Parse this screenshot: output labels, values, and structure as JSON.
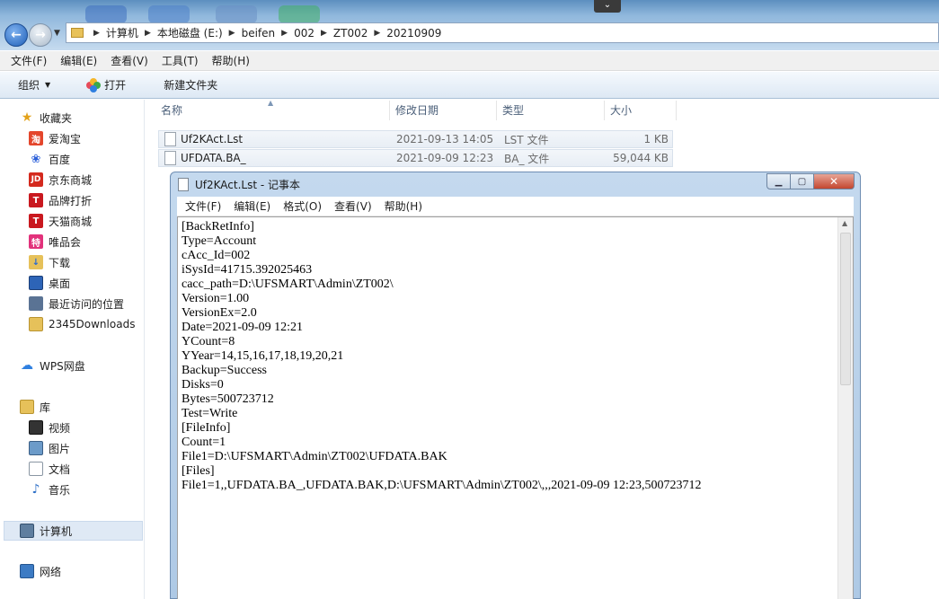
{
  "window": {
    "minimize_tab": "⌄"
  },
  "address": {
    "crumbs": [
      "计算机",
      "本地磁盘 (E:)",
      "beifen",
      "002",
      "ZT002",
      "20210909"
    ]
  },
  "menubar": {
    "items": [
      "文件(F)",
      "编辑(E)",
      "查看(V)",
      "工具(T)",
      "帮助(H)"
    ]
  },
  "commandbar": {
    "organize": "组织",
    "open": "打开",
    "new_folder": "新建文件夹"
  },
  "sidebar": {
    "favorites": "收藏夹",
    "fav_items": [
      "爱淘宝",
      "百度",
      "京东商城",
      "品牌打折",
      "天猫商城",
      "唯品会",
      "下载",
      "桌面",
      "最近访问的位置",
      "2345Downloads"
    ],
    "wps": "WPS网盘",
    "library": "库",
    "lib_items": [
      "视频",
      "图片",
      "文档",
      "音乐"
    ],
    "computer": "计算机",
    "network": "网络"
  },
  "file_list": {
    "headers": [
      "名称",
      "修改日期",
      "类型",
      "大小"
    ],
    "rows": [
      {
        "name": "Uf2KAct.Lst",
        "date": "2021-09-13 14:05",
        "type": "LST 文件",
        "size": "1 KB"
      },
      {
        "name": "UFDATA.BA_",
        "date": "2021-09-09 12:23",
        "type": "BA_ 文件",
        "size": "59,044 KB"
      }
    ]
  },
  "notepad": {
    "title": "Uf2KAct.Lst - 记事本",
    "menu": [
      "文件(F)",
      "编辑(E)",
      "格式(O)",
      "查看(V)",
      "帮助(H)"
    ],
    "content": "[BackRetInfo]\nType=Account\ncAcc_Id=002\niSysId=41715.392025463\ncacc_path=D:\\UFSMART\\Admin\\ZT002\\\nVersion=1.00\nVersionEx=2.0\nDate=2021-09-09 12:21\nYCount=8\nYYear=14,15,16,17,18,19,20,21\nBackup=Success\nDisks=0\nBytes=500723712\nTest=Write\n[FileInfo]\nCount=1\nFile1=D:\\UFSMART\\Admin\\ZT002\\UFDATA.BAK\n[Files]\nFile1=1,,UFDATA.BA_,UFDATA.BAK,D:\\UFSMART\\Admin\\ZT002\\,,,2021-09-09 12:23,500723712"
  }
}
